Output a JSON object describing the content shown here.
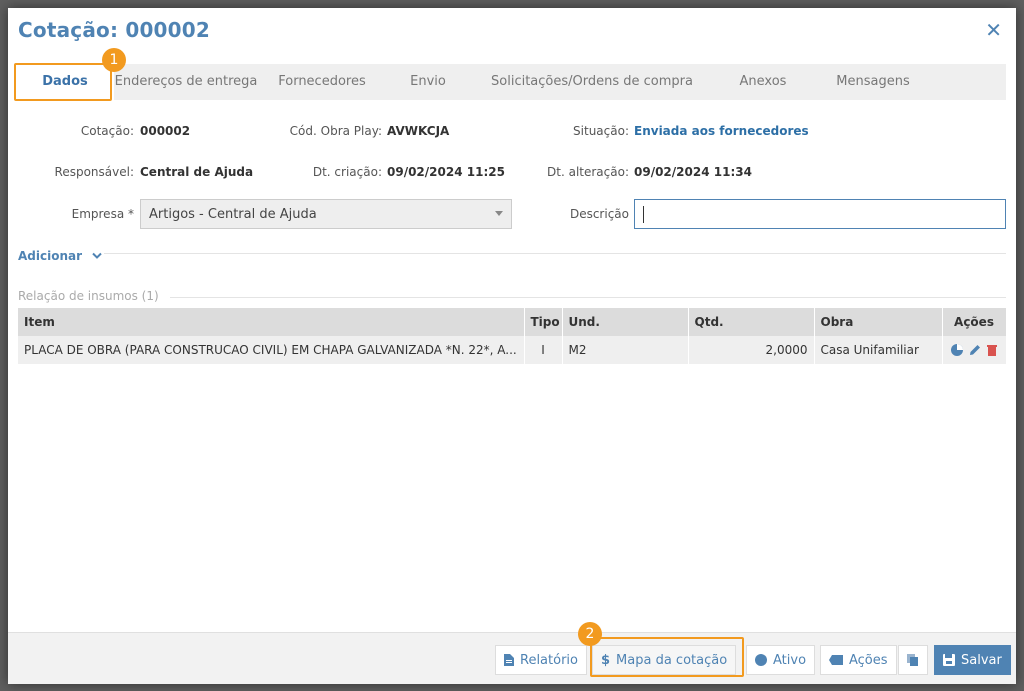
{
  "window": {
    "title": "Cotação: 000002",
    "close_glyph": "✕"
  },
  "tabs": [
    {
      "label": "Dados"
    },
    {
      "label": "Endereços de entrega"
    },
    {
      "label": "Fornecedores"
    },
    {
      "label": "Envio"
    },
    {
      "label": "Solicitações/Ordens de compra"
    },
    {
      "label": "Anexos"
    },
    {
      "label": "Mensagens"
    }
  ],
  "callouts": {
    "one": "1",
    "two": "2"
  },
  "fields": {
    "cotacao_label": "Cotação:",
    "cotacao_value": "000002",
    "obra_label": "Cód. Obra Play:",
    "obra_value": "AVWKCJA",
    "situacao_label": "Situação:",
    "situacao_value": "Enviada aos fornecedores",
    "responsavel_label": "Responsável:",
    "responsavel_value": "Central de Ajuda",
    "criacao_label": "Dt. criação:",
    "criacao_value": "09/02/2024 11:25",
    "alteracao_label": "Dt. alteração:",
    "alteracao_value": "09/02/2024 11:34",
    "empresa_label": "Empresa *",
    "empresa_value": "Artigos - Central de Ajuda",
    "descricao_label": "Descrição",
    "descricao_value": ""
  },
  "adicionar": {
    "label": "Adicionar"
  },
  "insumos": {
    "title": "Relação de insumos (1)",
    "columns": [
      "Item",
      "Tipo",
      "Und.",
      "Qtd.",
      "Obra",
      "Ações"
    ],
    "rows": [
      {
        "item": "PLACA DE OBRA (PARA CONSTRUCAO CIVIL) EM CHAPA GALVANIZADA *N. 22*, A...",
        "tipo": "I",
        "und": "M2",
        "qtd": "2,0000",
        "obra": "Casa Unifamiliar"
      }
    ]
  },
  "footer": {
    "relatorio": "Relatório",
    "mapa": "Mapa da cotação",
    "ativo": "Ativo",
    "acoes": "Ações",
    "salvar": "Salvar"
  },
  "colors": {
    "accent": "#4f83b3",
    "highlight": "#f29a1f",
    "delete": "#d9534f"
  }
}
